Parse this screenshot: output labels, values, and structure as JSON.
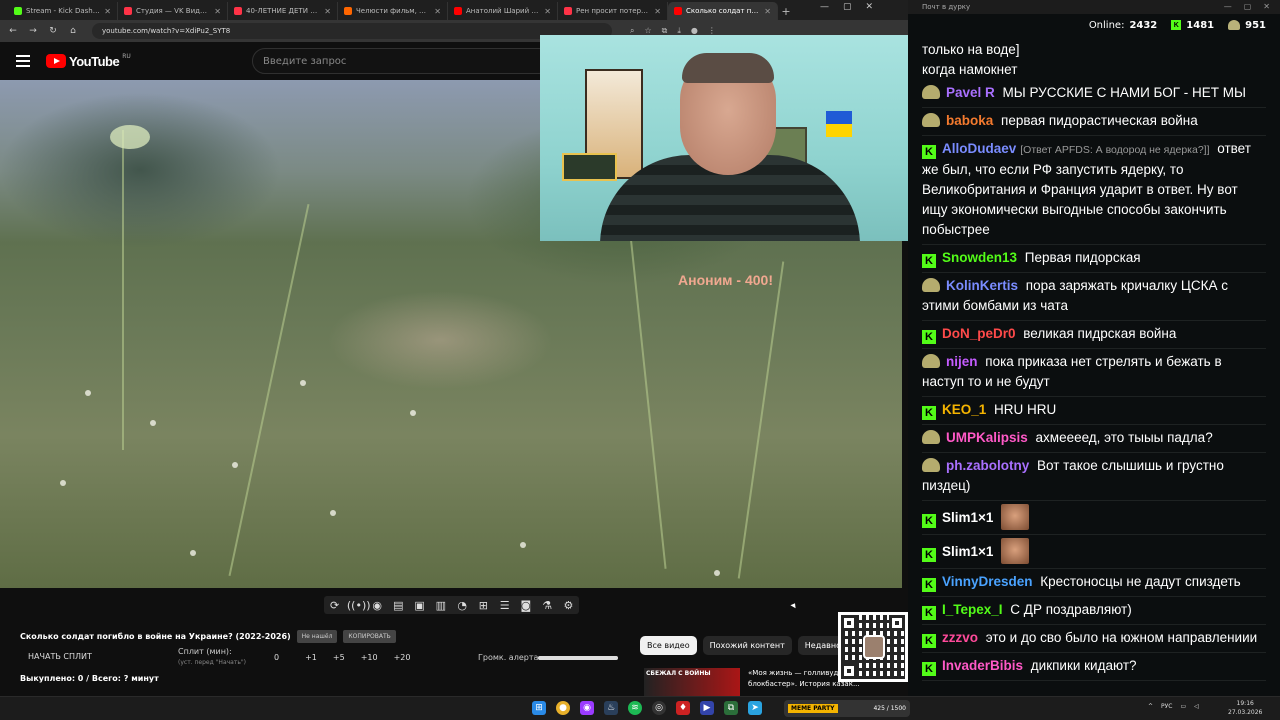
{
  "browser": {
    "tabs": [
      {
        "title": "Stream - Kick Dashboard",
        "color": "#53fc18",
        "active": false
      },
      {
        "title": "Студия — VK Видео Live",
        "color": "#ff3347",
        "active": false
      },
      {
        "title": "40-ЛЕТНИЕ ДЕТИ ДИСНЕЯ",
        "color": "#ff3347",
        "active": false
      },
      {
        "title": "Челюсти фильм, 1975, дата",
        "color": "#ff6600",
        "active": false
      },
      {
        "title": "Анатолий Шарий - YouTube",
        "color": "#ff0000",
        "active": false
      },
      {
        "title": "Рен просит потерпеть (-) - V",
        "color": "#ff3347",
        "active": false
      },
      {
        "title": "Сколько солдат погибло в",
        "color": "#ff0000",
        "active": true
      }
    ],
    "url": "youtube.com/watch?v=XdiPu2_SYT8"
  },
  "youtube": {
    "logo_text": "YouTube",
    "logo_region": "RU",
    "search_placeholder": "Введите запрос"
  },
  "video": {
    "overlay_text": "Аноним - 400!"
  },
  "panel": {
    "title": "Сколько солдат погибло в войне на Украине? (2022-2026)",
    "btn_not_found": "Не нашёл",
    "btn_copy": "КОПИРОВАТЬ",
    "split_start": "НАЧАТЬ СПЛИТ",
    "split_label": "Сплит (мин):",
    "split_sub": "(уст. перед \"Начать\")",
    "split_values": [
      "0",
      "+1",
      "+5",
      "+10",
      "+20"
    ],
    "alert_label": "Громк. алерта:",
    "alert_volume": 1.0,
    "bought": "Выкуплено: 0 / Всего: ? минут"
  },
  "chips": [
    {
      "label": "Все видео",
      "selected": true
    },
    {
      "label": "Похожий контент",
      "selected": false
    },
    {
      "label": "Недавно",
      "selected": false
    }
  ],
  "recommendation": {
    "thumb_text": "СБЕЖАЛ С ВОЙНЫ",
    "title": "«Моя жизнь — голливудский блокбастер». История казак..."
  },
  "taskbar": {
    "stream_badge": "MEME PARTY",
    "stream_count": "425 / 1500",
    "lang": "РУС",
    "time": "19:16",
    "date": "27.03.2026"
  },
  "chat": {
    "window_title": "Почт в дурку",
    "online_label": "Online:",
    "online_count": "2432",
    "kick_count": "1481",
    "vk_count": "951",
    "messages": [
      {
        "badge": "none",
        "user": "",
        "color": "#ffffff",
        "reply": "",
        "text": "только на воде]"
      },
      {
        "badge": "none",
        "user": "",
        "color": "#ffffff",
        "reply": "",
        "text": "когда намокнет"
      },
      {
        "badge": "p",
        "user": "Pavel R",
        "color": "#a970ff",
        "reply": "",
        "text": "МЫ РУССКИЕ С НАМИ БОГ - НЕТ МЫ"
      },
      {
        "badge": "p",
        "user": "baboka",
        "color": "#f47a2e",
        "reply": "",
        "text": "первая пидорастическая война"
      },
      {
        "badge": "k",
        "user": "AlloDudaev",
        "color": "#7a8cff",
        "reply": "[Ответ APFDS: А водород не ядерка?]]",
        "text": "ответ же был, что если РФ запустить ядерку, то Великобритания и Франция ударит в ответ. Ну вот ищу экономически выгодные способы закончить побыстрее"
      },
      {
        "badge": "k",
        "user": "Snowden13",
        "color": "#53fc18",
        "reply": "",
        "text": "Первая пидорская"
      },
      {
        "badge": "p",
        "user": "KolinKertis",
        "color": "#7a8cff",
        "reply": "",
        "text": "пора заряжать кричалку ЦСКА с этими бомбами из чата"
      },
      {
        "badge": "k",
        "user": "DoN_peDr0",
        "color": "#ff4a4a",
        "reply": "",
        "text": "великая пидрская война"
      },
      {
        "badge": "p",
        "user": "nijen",
        "color": "#c45cff",
        "reply": "",
        "text": "пока приказа нет стрелять и бежать в наступ то и не будут"
      },
      {
        "badge": "k",
        "user": "KEO_1",
        "color": "#f5b400",
        "reply": "",
        "text": "HRU HRU"
      },
      {
        "badge": "p",
        "user": "UMPKalipsis",
        "color": "#ff59c7",
        "reply": "",
        "text": "ахмеееед, это тыыы падла?"
      },
      {
        "badge": "p",
        "user": "ph.zabolotny",
        "color": "#a970ff",
        "reply": "",
        "text": "Вот такое слышишь и грустно пиздец)"
      },
      {
        "badge": "k",
        "user": "Slim1×1",
        "color": "#ffffff",
        "reply": "",
        "text": "",
        "emote": true
      },
      {
        "badge": "k",
        "user": "Slim1×1",
        "color": "#ffffff",
        "reply": "",
        "text": "",
        "emote": true
      },
      {
        "badge": "k",
        "user": "VinnyDresden",
        "color": "#4aa3ff",
        "reply": "",
        "text": "Крестоносцы не дадут спиздеть"
      },
      {
        "badge": "k",
        "user": "I_Tepex_I",
        "color": "#53fc18",
        "reply": "",
        "text": "С ДР поздравляют)"
      },
      {
        "badge": "k",
        "user": "zzzvo",
        "color": "#ff4a9a",
        "reply": "",
        "text": "это и до сво было на южном направлениии"
      },
      {
        "badge": "k",
        "user": "InvaderBibis",
        "color": "#ff59c7",
        "reply": "",
        "text": "дикпики кидают?"
      }
    ]
  }
}
